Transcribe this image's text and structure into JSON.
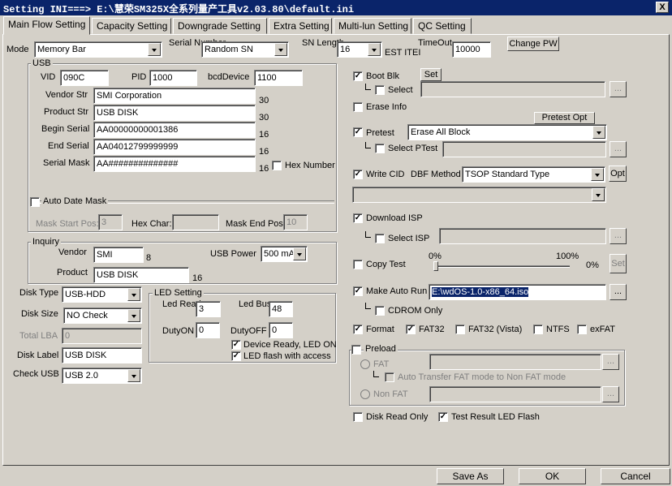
{
  "window": {
    "title": "Setting  INI===> E:\\慧荣SM325X全系列量产工具v2.03.80\\default.ini",
    "close": "X"
  },
  "tabs": [
    "Main Flow Setting",
    "Capacity Setting",
    "Downgrade Setting",
    "Extra Setting",
    "Multi-lun Setting",
    "QC Setting"
  ],
  "top": {
    "mode_label": "Mode",
    "mode_value": "Memory Bar",
    "serial_number_label": "Serial Number",
    "serial_number_value": "Random SN",
    "sn_length_label": "SN Length",
    "sn_length_value": "16",
    "test_item_label": "EST ITEI",
    "timeout_label": "TimeOut",
    "timeout_value": "10000",
    "change_pw": "Change PW"
  },
  "usb": {
    "title": "USB",
    "vid_label": "VID",
    "vid": "090C",
    "pid_label": "PID",
    "pid": "1000",
    "bcd_label": "bcdDevice",
    "bcd": "1100",
    "vendor_str_label": "Vendor Str",
    "vendor_str": "SMI Corporation",
    "vendor_str_len": "30",
    "product_str_label": "Product Str",
    "product_str": "USB DISK",
    "product_str_len": "30",
    "begin_serial_label": "Begin Serial",
    "begin_serial": "AA00000000001386",
    "begin_serial_len": "16",
    "end_serial_label": "End Serial",
    "end_serial": "AA04012799999999",
    "end_serial_len": "16",
    "serial_mask_label": "Serial Mask",
    "serial_mask": "AA##############",
    "serial_mask_len": "16",
    "hex_number": "Hex Number",
    "auto_date_mask": "Auto Date Mask",
    "mask_start_label": "Mask Start Pos:",
    "mask_start": "3",
    "hex_char_label": "Hex Char:",
    "hex_char": "",
    "mask_end_label": "Mask End Pos:",
    "mask_end": "10"
  },
  "inquiry": {
    "title": "Inquiry",
    "vendor_label": "Vendor",
    "vendor": "SMI",
    "vendor_len": "8",
    "product_label": "Product",
    "product": "USB DISK",
    "product_len": "16",
    "usb_power_label": "USB Power",
    "usb_power": "500 mA"
  },
  "disk": {
    "type_label": "Disk Type",
    "type": "USB-HDD",
    "size_label": "Disk Size",
    "size": "NO Check",
    "total_lba_label": "Total LBA",
    "total_lba": "0",
    "label_label": "Disk Label",
    "label": "USB DISK",
    "check_usb_label": "Check USB",
    "check_usb": "USB 2.0"
  },
  "led": {
    "title": "LED Setting",
    "ready_label": "Led Ready",
    "ready": "3",
    "busy_label": "Led Busy",
    "busy": "48",
    "dutyon_label": "DutyON",
    "dutyon": "0",
    "dutyoff_label": "DutyOFF",
    "dutyoff": "0",
    "device_ready": "Device Ready, LED ON",
    "flash_access": "LED flash with access"
  },
  "right": {
    "boot_blk": "Boot Blk",
    "set": "Set",
    "select": "Select",
    "browse": "...",
    "erase_info": "Erase Info",
    "pretest_opt": "Pretest Opt",
    "pretest": "Pretest",
    "pretest_value": "Erase All Block",
    "select_ptest": "Select PTest",
    "write_cid": "Write CID",
    "dbf_method_label": "DBF Method",
    "dbf_method": "TSOP Standard Type",
    "opt": "Opt",
    "download_isp": "Download ISP",
    "select_isp": "Select ISP",
    "copy_test": "Copy Test",
    "pct_0": "0%",
    "pct_100": "100%",
    "pct_value": "0%",
    "make_auto_run": "Make Auto Run",
    "auto_run_path": "E:\\wdOS-1.0-x86_64.iso",
    "cdrom_only": "CDROM Only",
    "format": "Format",
    "fat32": "FAT32",
    "fat32_vista": "FAT32 (Vista)",
    "ntfs": "NTFS",
    "exfat": "exFAT",
    "preload": "Preload",
    "fat": "FAT",
    "auto_transfer": "Auto Transfer FAT mode to Non FAT mode",
    "non_fat": "Non FAT",
    "disk_read_only": "Disk Read Only",
    "test_result_led": "Test Result LED Flash"
  },
  "footer": {
    "save_as": "Save As",
    "ok": "OK",
    "cancel": "Cancel"
  },
  "checkmark": "✓"
}
